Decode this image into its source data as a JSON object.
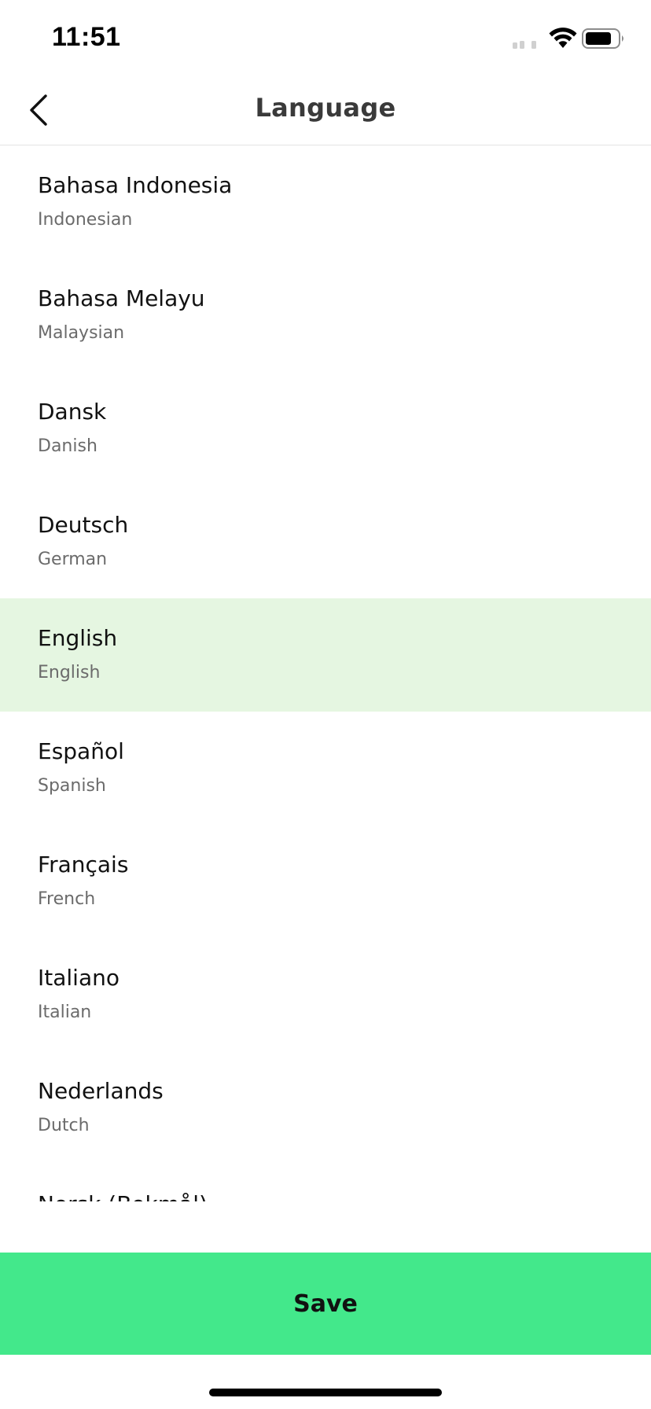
{
  "status_bar": {
    "time": "11:51",
    "icons": [
      "signal-icon",
      "wifi-icon",
      "battery-icon"
    ]
  },
  "header": {
    "title": "Language",
    "back_icon": "chevron-left-icon"
  },
  "languages": [
    {
      "name": "Bahasa Indonesia",
      "english": "Indonesian",
      "selected": false
    },
    {
      "name": "Bahasa Melayu",
      "english": "Malaysian",
      "selected": false
    },
    {
      "name": "Dansk",
      "english": "Danish",
      "selected": false
    },
    {
      "name": "Deutsch",
      "english": "German",
      "selected": false
    },
    {
      "name": "English",
      "english": "English",
      "selected": true
    },
    {
      "name": "Español",
      "english": "Spanish",
      "selected": false
    },
    {
      "name": "Français",
      "english": "French",
      "selected": false
    },
    {
      "name": "Italiano",
      "english": "Italian",
      "selected": false
    },
    {
      "name": "Nederlands",
      "english": "Dutch",
      "selected": false
    },
    {
      "name": "Norsk (Bokmål)",
      "english": "",
      "selected": false
    }
  ],
  "footer": {
    "save_label": "Save"
  },
  "colors": {
    "accent": "#43e88b",
    "selected_row": "#e5f6e1",
    "secondary_text": "#6b6b6b"
  }
}
